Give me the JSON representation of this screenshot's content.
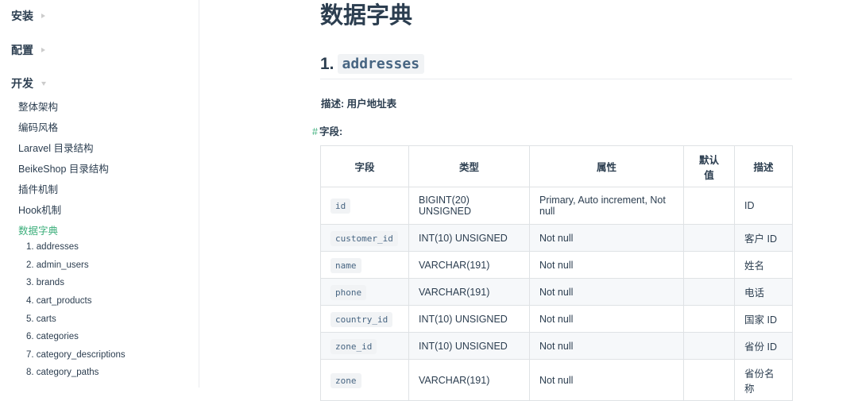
{
  "sidebar": {
    "groups": [
      {
        "label": "安装"
      },
      {
        "label": "配置"
      },
      {
        "label": "开发"
      }
    ],
    "links": [
      {
        "label": "整体架构"
      },
      {
        "label": "编码风格"
      },
      {
        "label": "Laravel 目录结构"
      },
      {
        "label": "BeikeShop 目录结构"
      },
      {
        "label": "插件机制"
      },
      {
        "label": "Hook机制"
      },
      {
        "label": "数据字典"
      }
    ],
    "sublinks": [
      {
        "label": "1. addresses"
      },
      {
        "label": "2. admin_users"
      },
      {
        "label": "3. brands"
      },
      {
        "label": "4. cart_products"
      },
      {
        "label": "5. carts"
      },
      {
        "label": "6. categories"
      },
      {
        "label": "7. category_descriptions"
      },
      {
        "label": "8. category_paths"
      }
    ]
  },
  "main": {
    "title": "数据字典",
    "section_number": "1.",
    "section_name": "addresses",
    "description": "描述: 用户地址表",
    "fields_hash": "#",
    "fields_label": "字段:",
    "table": {
      "headers": [
        "字段",
        "类型",
        "属性",
        "默认值",
        "描述"
      ],
      "rows": [
        [
          "id",
          "BIGINT(20) UNSIGNED",
          "Primary, Auto increment, Not null",
          "",
          "ID"
        ],
        [
          "customer_id",
          "INT(10) UNSIGNED",
          "Not null",
          "",
          "客户 ID"
        ],
        [
          "name",
          "VARCHAR(191)",
          "Not null",
          "",
          "姓名"
        ],
        [
          "phone",
          "VARCHAR(191)",
          "Not null",
          "",
          "电话"
        ],
        [
          "country_id",
          "INT(10) UNSIGNED",
          "Not null",
          "",
          "国家 ID"
        ],
        [
          "zone_id",
          "INT(10) UNSIGNED",
          "Not null",
          "",
          "省份 ID"
        ],
        [
          "zone",
          "VARCHAR(191)",
          "Not null",
          "",
          "省份名称"
        ]
      ]
    }
  }
}
